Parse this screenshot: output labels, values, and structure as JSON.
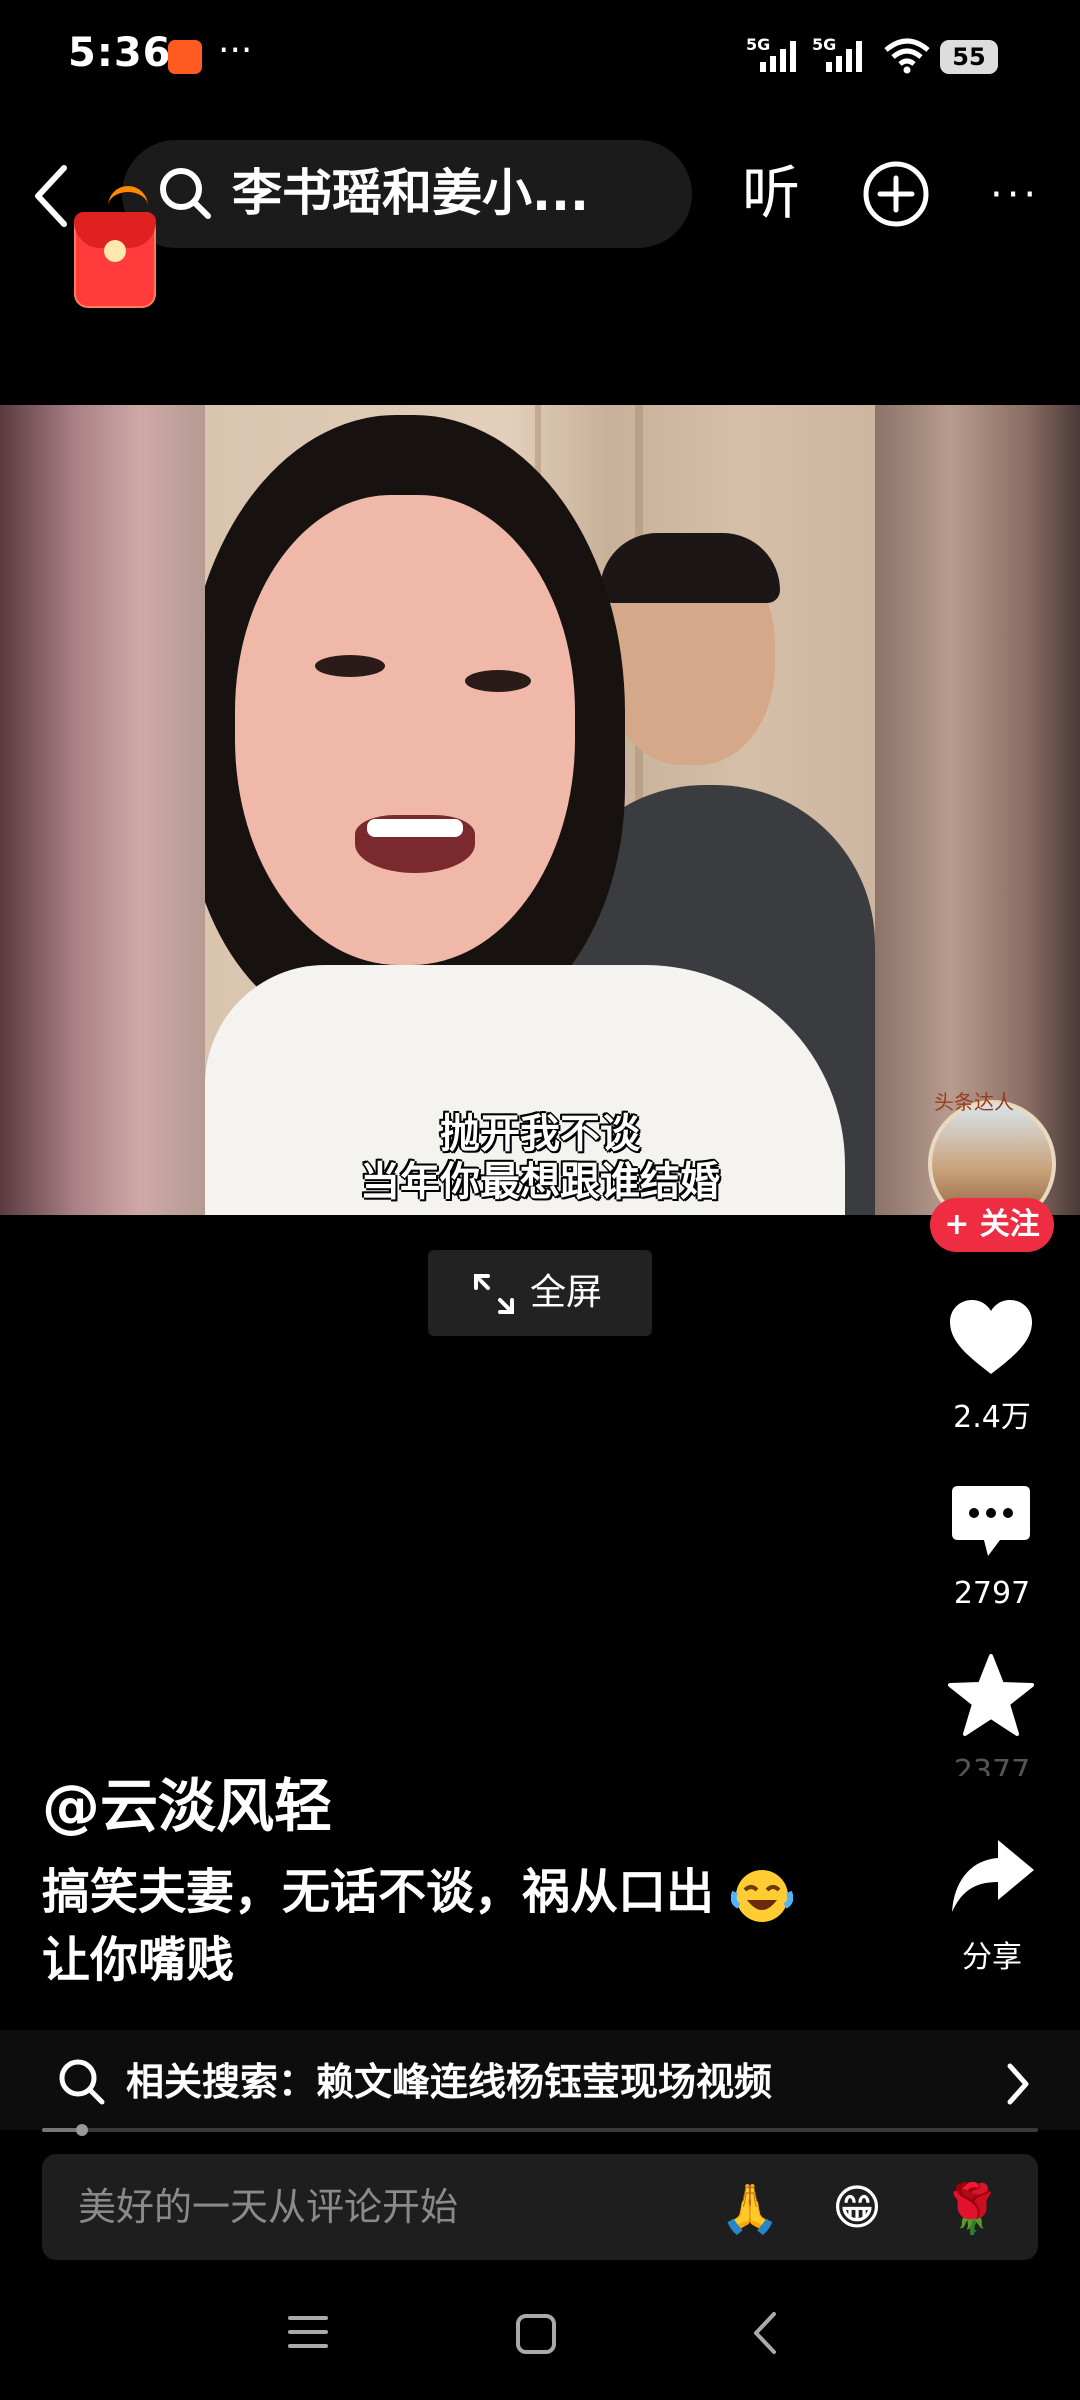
{
  "status_bar": {
    "time": "5:36",
    "more": "···",
    "network1": "5G",
    "network2": "5G",
    "battery": "55"
  },
  "top_nav": {
    "search_text": "李书瑶和姜小...",
    "listen_label": "听",
    "more_label": "···"
  },
  "video": {
    "subtitle_line1": "抛开我不谈",
    "subtitle_line2": "当年你最想跟谁结婚",
    "fullscreen_label": "全屏"
  },
  "right_rail": {
    "avatar_tag": "头条达人",
    "follow_label": "+ 关注",
    "like_count": "2.4万",
    "comment_count": "2797",
    "favorite_count": "2377",
    "share_label": "分享"
  },
  "caption": {
    "author": "@云淡风轻",
    "description_line1": "搞笑夫妻，无话不谈，祸从口出",
    "description_line2": "让你嘴贱"
  },
  "related_search": {
    "label": "相关搜索：赖文峰连线杨钰莹现场视频"
  },
  "playback": {
    "progress_fraction": 0.04
  },
  "comment_bar": {
    "placeholder": "美好的一天从评论开始",
    "emoji_pray": "🙏",
    "emoji_grin": "😁",
    "emoji_rose": "🌹"
  },
  "colors": {
    "follow_button": "#ee2d43",
    "background": "#000000"
  }
}
